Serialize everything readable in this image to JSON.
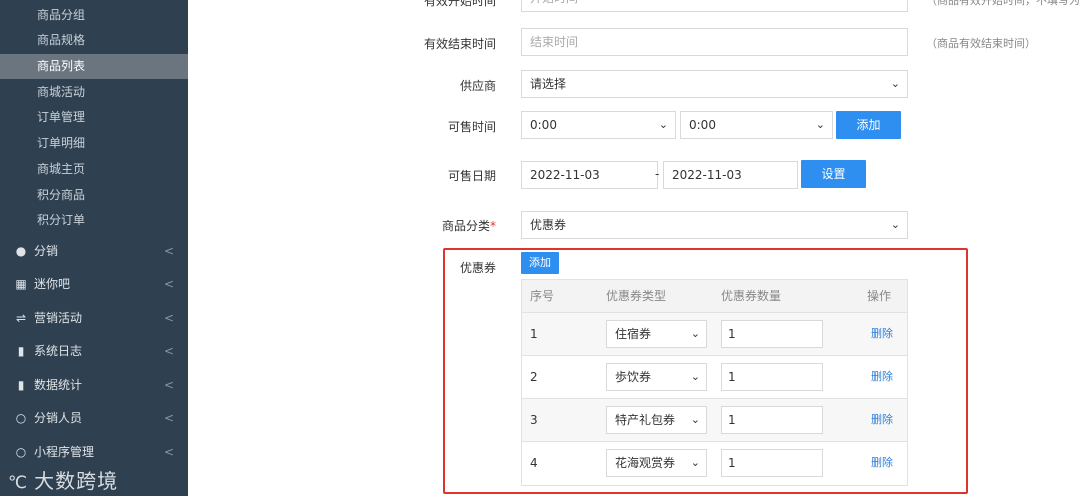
{
  "sidebar": {
    "sub_items": [
      {
        "label": "商品分组",
        "active": false
      },
      {
        "label": "商品规格",
        "active": false
      },
      {
        "label": "商品列表",
        "active": true
      },
      {
        "label": "商城活动",
        "active": false
      },
      {
        "label": "订单管理",
        "active": false
      },
      {
        "label": "订单明细",
        "active": false
      },
      {
        "label": "商城主页",
        "active": false
      },
      {
        "label": "积分商品",
        "active": false
      },
      {
        "label": "积分订单",
        "active": false
      }
    ],
    "main_items": [
      {
        "label": "分销",
        "icon": "users-icon"
      },
      {
        "label": "迷你吧",
        "icon": "grid-icon"
      },
      {
        "label": "营销活动",
        "icon": "shuffle-icon"
      },
      {
        "label": "系统日志",
        "icon": "file-icon"
      },
      {
        "label": "数据统计",
        "icon": "file-icon"
      },
      {
        "label": "分销人员",
        "icon": "chat-icon"
      },
      {
        "label": "小程序管理",
        "icon": "chat-icon"
      }
    ],
    "arrow": "<"
  },
  "watermark": {
    "logo": "℃",
    "text": "大数跨境"
  },
  "form": {
    "start_time": {
      "label": "有效开始时间",
      "placeholder": "开始时间",
      "hint": "（商品有效开始时间，不填写为永"
    },
    "end_time": {
      "label": "有效结束时间",
      "placeholder": "结束时间",
      "hint": "（商品有效结束时间）"
    },
    "supplier": {
      "label": "供应商",
      "value": "请选择"
    },
    "sale_time": {
      "label": "可售时间",
      "from": "0:00",
      "to": "0:00",
      "add_button": "添加"
    },
    "sale_date": {
      "label": "可售日期",
      "from": "2022-11-03",
      "separator": "-",
      "to": "2022-11-03",
      "set_button": "设置"
    },
    "category": {
      "label": "商品分类",
      "required_mark": "*",
      "value": "优惠券"
    },
    "coupon": {
      "label": "优惠券",
      "add_button": "添加"
    }
  },
  "coupon_table": {
    "headers": [
      "序号",
      "优惠券类型",
      "优惠券数量",
      "操作"
    ],
    "rows": [
      {
        "index": "1",
        "type": "住宿券",
        "qty": "1",
        "action": "删除"
      },
      {
        "index": "2",
        "type": "歩饮券",
        "qty": "1",
        "action": "删除"
      },
      {
        "index": "3",
        "type": "特产礼包券",
        "qty": "1",
        "action": "删除"
      },
      {
        "index": "4",
        "type": "花海观赏券",
        "qty": "1",
        "action": "删除"
      }
    ]
  },
  "colors": {
    "sidebar_bg": "#2f4050",
    "active_bg": "#6b7580",
    "primary": "#2f8ff0",
    "highlight_border": "#e0342b",
    "link": "#2f7fd8"
  }
}
